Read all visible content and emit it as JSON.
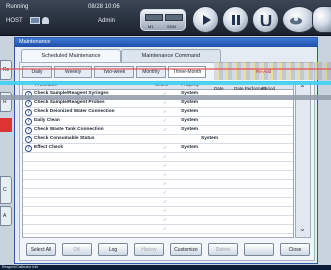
{
  "status_bar": {
    "status": "Running",
    "datetime": "08/28 10:06",
    "host": "HOST",
    "user": "Admin",
    "analyzer_labels": [
      "M1",
      "SDM"
    ]
  },
  "dialog": {
    "title": "Maintenance",
    "top_tabs": [
      {
        "label": "Scheduled Maintenance",
        "active": true
      },
      {
        "label": "Maintenance Command",
        "active": false
      }
    ],
    "sub_tabs": [
      {
        "label": "Daily",
        "active": false
      },
      {
        "label": "Weekly",
        "active": false
      },
      {
        "label": "Two-week",
        "active": false
      },
      {
        "label": "Monthly",
        "active": false
      },
      {
        "label": "Three-Month",
        "active": true
      }
    ],
    "columns": [
      "Procedure",
      "Select",
      "Property"
    ],
    "rows": [
      {
        "name": "Check Sample/Reagent Syringes",
        "select": "✓",
        "property": "System"
      },
      {
        "name": "Check Sample/Reagent Probes",
        "select": "✓",
        "property": "System"
      },
      {
        "name": "Check Deionized Water Connection",
        "select": "✓",
        "property": "System"
      },
      {
        "name": "Daily Clean",
        "select": "✓",
        "property": "System"
      },
      {
        "name": "Check Waste Tank Connection",
        "select": "✓",
        "property": "System"
      },
      {
        "name": "Check Consumable Status",
        "select": "",
        "property": "System"
      },
      {
        "name": "Effect Check",
        "select": "✓",
        "property": "System"
      }
    ],
    "empty_select_marks": [
      "✓",
      "✓",
      "✓",
      "✓",
      "✓",
      "✓",
      "✓",
      "✓",
      "✓"
    ],
    "buttons": [
      {
        "label": "Select All",
        "enabled": true
      },
      {
        "label": "OK",
        "enabled": false
      },
      {
        "label": "Log",
        "enabled": true
      },
      {
        "label": "History",
        "enabled": false
      },
      {
        "label": "Customize",
        "enabled": true
      },
      {
        "label": "Delete",
        "enabled": false
      },
      {
        "label": "",
        "enabled": false
      },
      {
        "label": "Close",
        "enabled": true
      }
    ]
  },
  "overlay": {
    "text1": "Re-Add",
    "text2": "Date",
    "text3": "Date Performed",
    "text4": "Period"
  },
  "side_buttons": [
    "Re",
    "R",
    "C",
    "A"
  ],
  "taskbar": {
    "text": "Reagent/Calibrator Info"
  }
}
